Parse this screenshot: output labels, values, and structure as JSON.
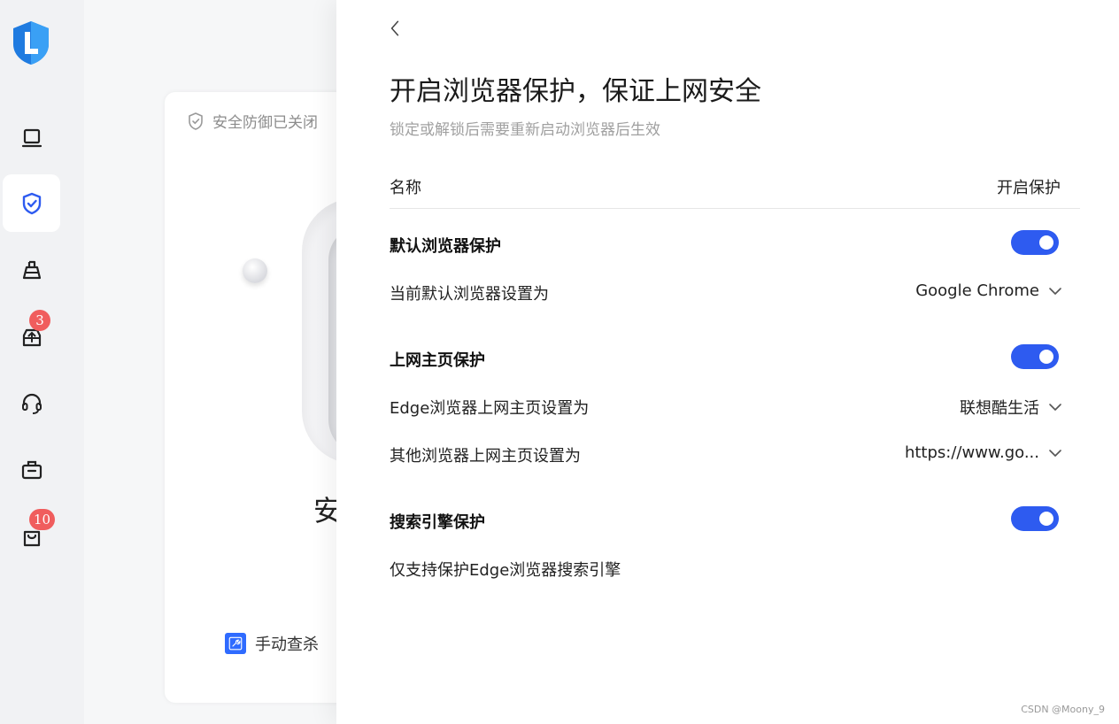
{
  "sidebar": {
    "items": [
      {
        "icon": "laptop-icon"
      },
      {
        "icon": "shield-check-icon",
        "active": true
      },
      {
        "icon": "broom-icon"
      },
      {
        "icon": "upload-drive-icon",
        "badge": "3"
      },
      {
        "icon": "headset-icon"
      },
      {
        "icon": "toolbox-icon"
      },
      {
        "icon": "shopping-bag-icon",
        "badge": "10"
      }
    ]
  },
  "background_card": {
    "status": "安全防御已关闭",
    "big_char": "安",
    "action": "手动查杀"
  },
  "drawer": {
    "title": "开启浏览器保护，保证上网安全",
    "subtitle": "锁定或解锁后需要重新启动浏览器后生效",
    "col_name": "名称",
    "col_protect": "开启保护",
    "sections": {
      "default_browser": {
        "title": "默认浏览器保护",
        "enabled": true,
        "row_label": "当前默认浏览器设置为",
        "value": "Google Chrome"
      },
      "homepage": {
        "title": "上网主页保护",
        "enabled": true,
        "edge_label": "Edge浏览器上网主页设置为",
        "edge_value": "联想酷生活",
        "other_label": "其他浏览器上网主页设置为",
        "other_value": "https://www.go..."
      },
      "search": {
        "title": "搜索引擎保护",
        "enabled": true,
        "note": "仅支持保护Edge浏览器搜索引擎"
      }
    }
  },
  "watermark": "CSDN @Moony_9",
  "colors": {
    "accent": "#2e5bf0",
    "badge": "#f05d5d",
    "logo_blue": "#1f7be0"
  }
}
